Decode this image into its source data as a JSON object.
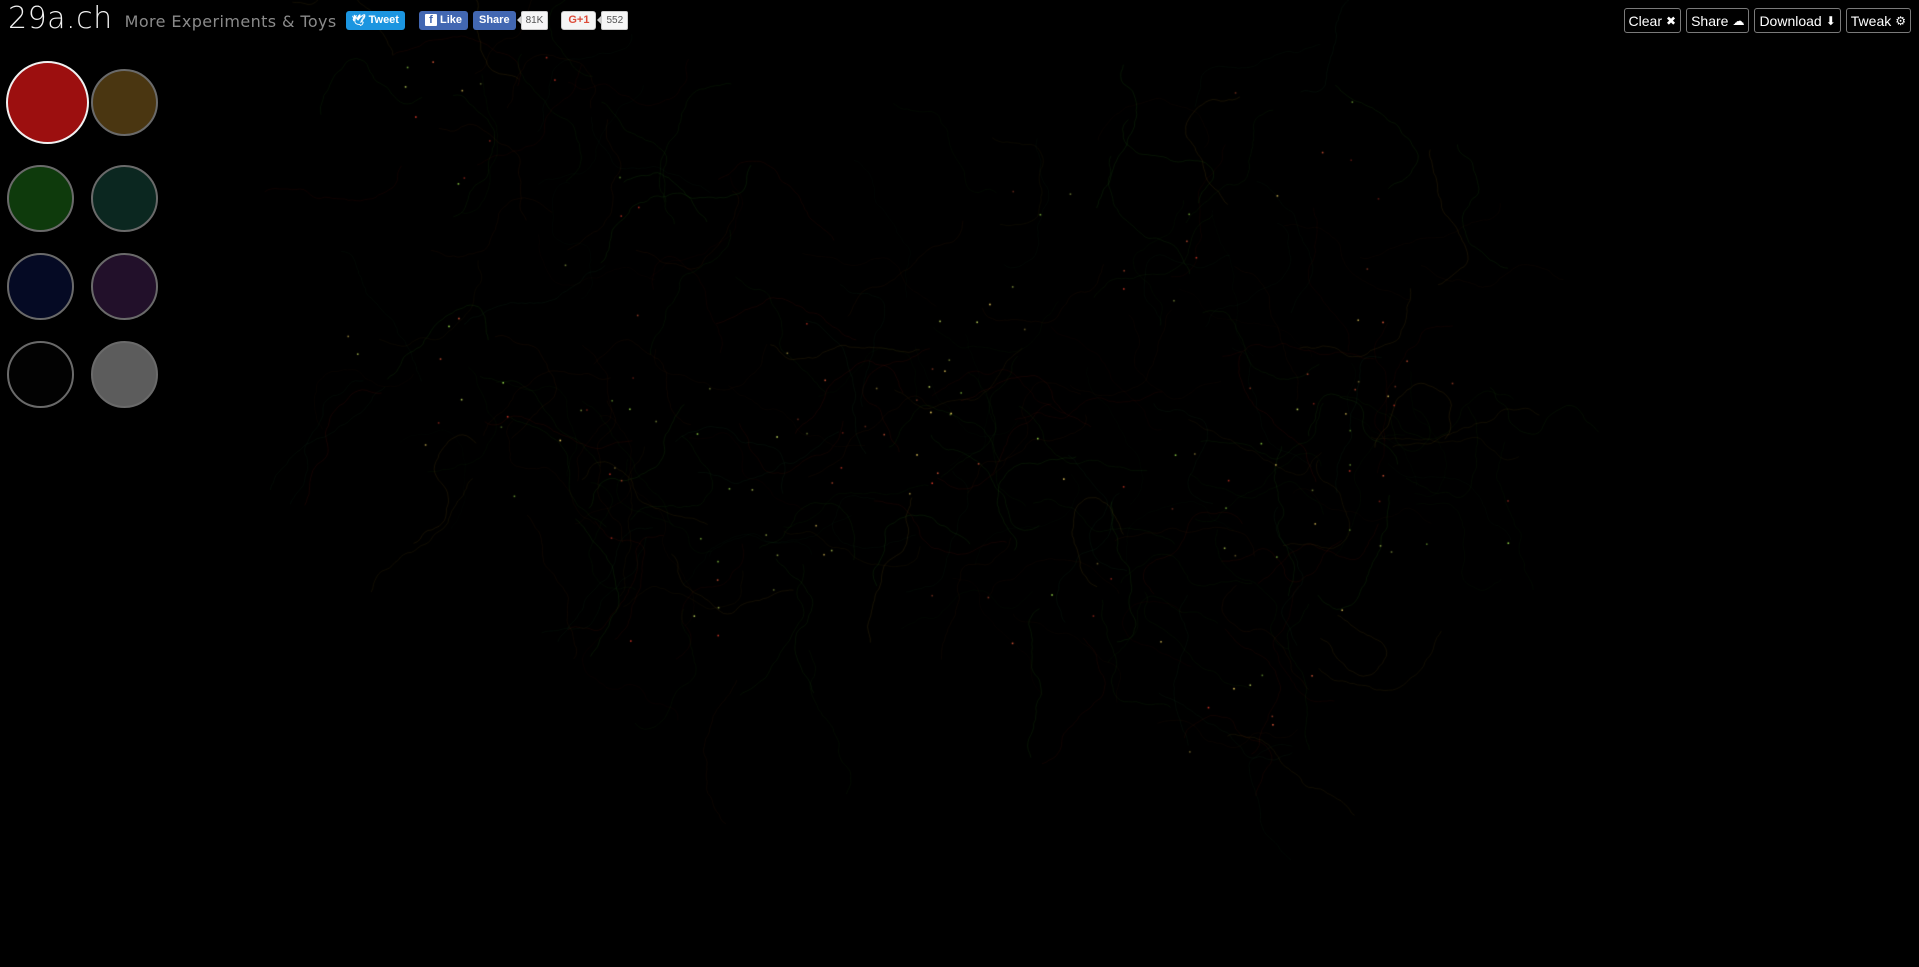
{
  "header": {
    "logo": "29a.ch",
    "tagline": "More Experiments & Toys"
  },
  "social": {
    "tweet_label": "Tweet",
    "like_label": "Like",
    "share_label": "Share",
    "share_count": "81K",
    "gplus_label": "G+1",
    "gplus_count": "552"
  },
  "toolbar": {
    "clear_label": "Clear",
    "share_label": "Share",
    "download_label": "Download",
    "tweak_label": "Tweak"
  },
  "palette": {
    "selected_index": 0,
    "colors": [
      "#9c0f0f",
      "#4a3611",
      "#0e3a0c",
      "#0b2720",
      "#050a24",
      "#22102a",
      "#020202",
      "#5c5c5c"
    ]
  },
  "icons": {
    "tweet": "twitter-bird-icon",
    "like": "facebook-icon",
    "clear": "close-icon",
    "share": "cloud-upload-icon",
    "download": "download-icon",
    "tweak": "gear-icon"
  }
}
